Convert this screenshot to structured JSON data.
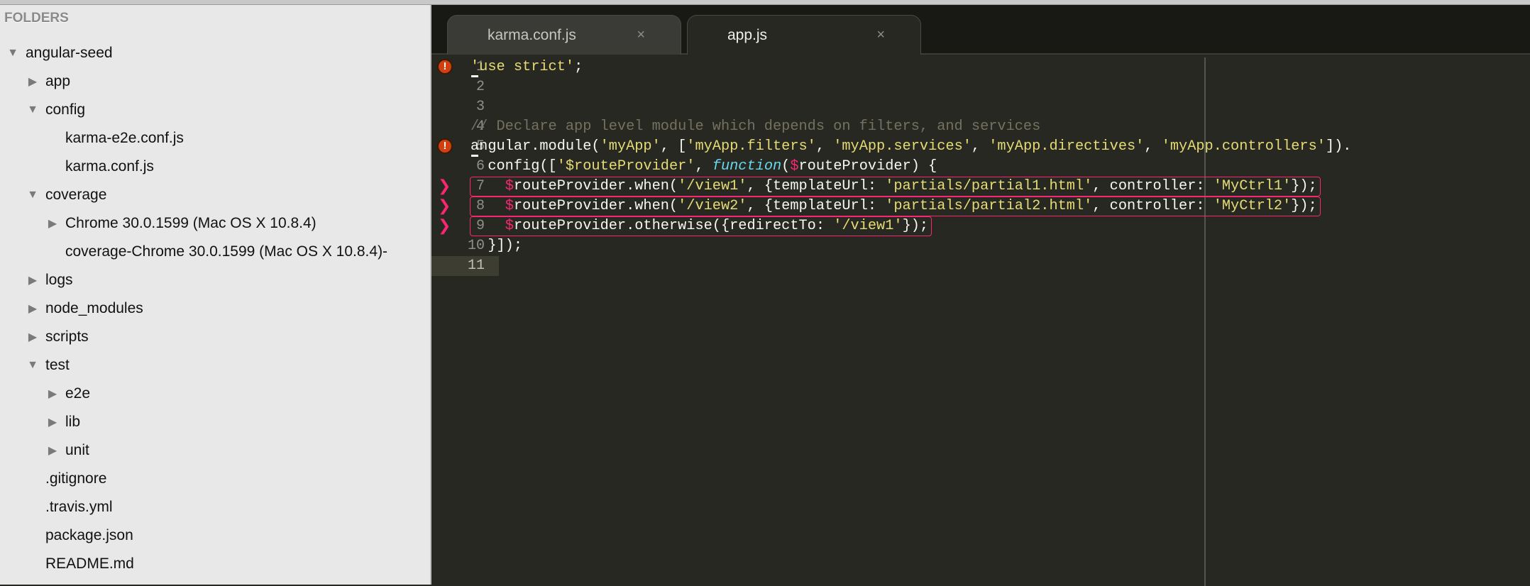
{
  "sidebar": {
    "header": "FOLDERS",
    "items": [
      {
        "label": "angular-seed",
        "level": 0,
        "expander": "expanded"
      },
      {
        "label": "app",
        "level": 1,
        "expander": "collapsed"
      },
      {
        "label": "config",
        "level": 1,
        "expander": "expanded"
      },
      {
        "label": "karma-e2e.conf.js",
        "level": 2,
        "expander": "none"
      },
      {
        "label": "karma.conf.js",
        "level": 2,
        "expander": "none"
      },
      {
        "label": "coverage",
        "level": 1,
        "expander": "expanded"
      },
      {
        "label": "Chrome 30.0.1599 (Mac OS X 10.8.4)",
        "level": 2,
        "expander": "collapsed"
      },
      {
        "label": "coverage-Chrome 30.0.1599 (Mac OS X 10.8.4)-",
        "level": 2,
        "expander": "none"
      },
      {
        "label": "logs",
        "level": 1,
        "expander": "collapsed"
      },
      {
        "label": "node_modules",
        "level": 1,
        "expander": "collapsed"
      },
      {
        "label": "scripts",
        "level": 1,
        "expander": "collapsed"
      },
      {
        "label": "test",
        "level": 1,
        "expander": "expanded"
      },
      {
        "label": "e2e",
        "level": 2,
        "expander": "collapsed"
      },
      {
        "label": "lib",
        "level": 2,
        "expander": "collapsed"
      },
      {
        "label": "unit",
        "level": 2,
        "expander": "collapsed"
      },
      {
        "label": ".gitignore",
        "level": 1,
        "expander": "none"
      },
      {
        "label": ".travis.yml",
        "level": 1,
        "expander": "none"
      },
      {
        "label": "package.json",
        "level": 1,
        "expander": "none"
      },
      {
        "label": "README.md",
        "level": 1,
        "expander": "none"
      }
    ]
  },
  "tabs": [
    {
      "label": "karma.conf.js",
      "close": "×",
      "active": false
    },
    {
      "label": "app.js",
      "close": "×",
      "active": true
    }
  ],
  "editor": {
    "current_line": 11,
    "gutter_markers": {
      "1": "error-icon",
      "5": "error-icon",
      "7": "arrow-icon",
      "8": "arrow-icon",
      "9": "arrow-icon"
    },
    "error_glyph": "!",
    "arrow_glyph": "❯",
    "boxed_lines": [
      7,
      8,
      9
    ],
    "colors": {
      "background": "#272822",
      "string": "#e6db74",
      "comment": "#75715e",
      "keyword": "#66d9ef",
      "variable": "#f92672",
      "box": "#f92672"
    },
    "lines": [
      [
        [
          "'use strict'",
          "s"
        ],
        [
          ";",
          "p"
        ]
      ],
      [],
      [],
      [
        [
          "// Declare app level module which depends on filters, and services",
          "c"
        ]
      ],
      [
        [
          "angular.module(",
          "p"
        ],
        [
          "'myApp'",
          "s"
        ],
        [
          ", [",
          "p"
        ],
        [
          "'myApp.filters'",
          "s"
        ],
        [
          ", ",
          "p"
        ],
        [
          "'myApp.services'",
          "s"
        ],
        [
          ", ",
          "p"
        ],
        [
          "'myApp.directives'",
          "s"
        ],
        [
          ", ",
          "p"
        ],
        [
          "'myApp.controllers'",
          "s"
        ],
        [
          "]).",
          "p"
        ]
      ],
      [
        [
          "  config([",
          "p"
        ],
        [
          "'$routeProvider'",
          "s"
        ],
        [
          ", ",
          "p"
        ],
        [
          "function",
          "f"
        ],
        [
          "(",
          "p"
        ],
        [
          "$",
          "d"
        ],
        [
          "routeProvider) {",
          "p"
        ]
      ],
      [
        [
          "    ",
          "p"
        ],
        [
          "$",
          "d"
        ],
        [
          "routeProvider.when(",
          "p"
        ],
        [
          "'/view1'",
          "s"
        ],
        [
          ", {templateUrl: ",
          "p"
        ],
        [
          "'partials/partial1.html'",
          "s"
        ],
        [
          ", controller: ",
          "p"
        ],
        [
          "'MyCtrl1'",
          "s"
        ],
        [
          "});",
          "p"
        ]
      ],
      [
        [
          "    ",
          "p"
        ],
        [
          "$",
          "d"
        ],
        [
          "routeProvider.when(",
          "p"
        ],
        [
          "'/view2'",
          "s"
        ],
        [
          ", {templateUrl: ",
          "p"
        ],
        [
          "'partials/partial2.html'",
          "s"
        ],
        [
          ", controller: ",
          "p"
        ],
        [
          "'MyCtrl2'",
          "s"
        ],
        [
          "});",
          "p"
        ]
      ],
      [
        [
          "    ",
          "p"
        ],
        [
          "$",
          "d"
        ],
        [
          "routeProvider.otherwise({redirectTo: ",
          "p"
        ],
        [
          "'/view1'",
          "s"
        ],
        [
          "});",
          "p"
        ]
      ],
      [
        [
          "  }]);",
          "p"
        ]
      ],
      []
    ]
  }
}
